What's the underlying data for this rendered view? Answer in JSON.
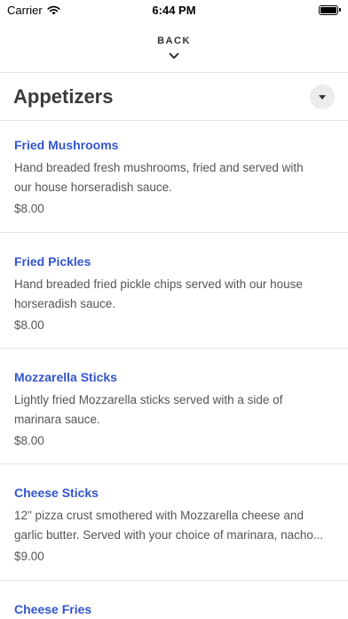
{
  "status_bar": {
    "carrier": "Carrier",
    "time": "6:44 PM"
  },
  "nav": {
    "back_label": "BACK"
  },
  "section": {
    "title": "Appetizers"
  },
  "items": [
    {
      "name": "Fried Mushrooms",
      "description": "Hand breaded fresh mushrooms, fried and served with\nour house horseradish sauce.",
      "price": "$8.00"
    },
    {
      "name": "Fried Pickles",
      "description": "Hand breaded fried pickle chips served with our house\nhorseradish sauce.",
      "price": "$8.00"
    },
    {
      "name": "Mozzarella Sticks",
      "description": "Lightly fried Mozzarella sticks served with a side of\nmarinara sauce.",
      "price": "$8.00"
    },
    {
      "name": "Cheese Sticks",
      "description": "12\" pizza crust smothered with Mozzarella cheese and\ngarlic butter. Served with your choice of marinara, nacho...",
      "price": "$9.00"
    },
    {
      "name": "Cheese Fries",
      "description": "",
      "price": ""
    }
  ],
  "colors": {
    "item_name": "#3355cc",
    "body_text": "#555555",
    "divider": "#e6e6e6",
    "title": "#3a3a3a"
  }
}
